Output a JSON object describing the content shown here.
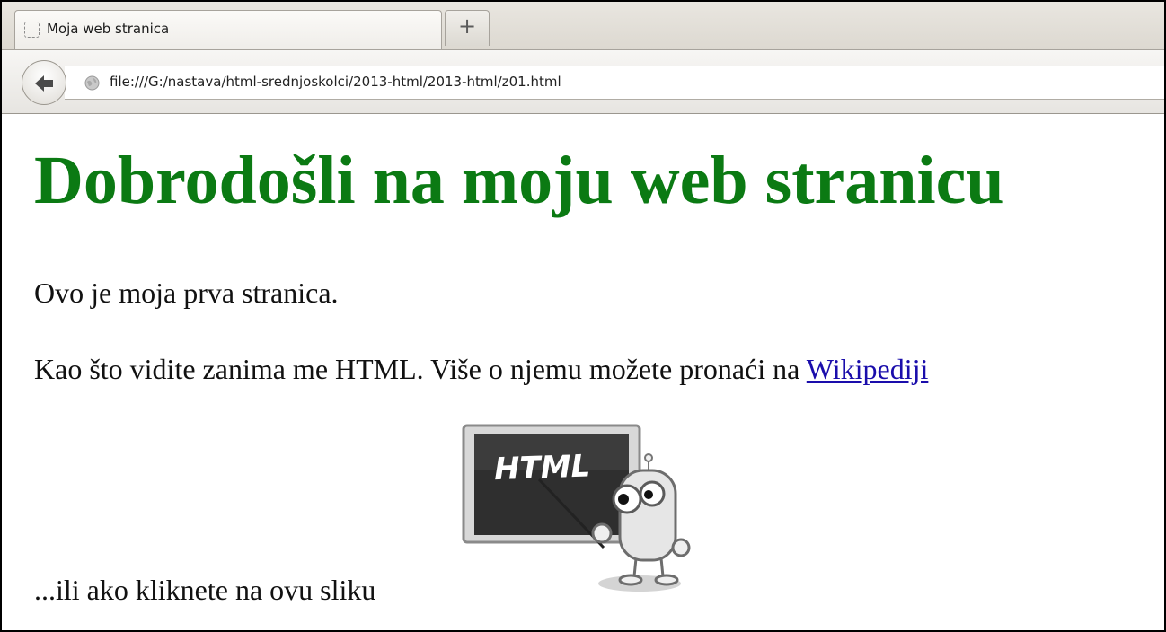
{
  "tab": {
    "title": "Moja web stranica",
    "new_tab_label": "+"
  },
  "navbar": {
    "back_icon": "back-arrow-icon",
    "url": "file:///G:/nastava/html-srednjoskolci/2013-html/2013-html/z01.html"
  },
  "page": {
    "heading": "Dobrodošli na moju web stranicu",
    "heading_color": "#0b7a13",
    "paragraph1": "Ovo je moja prva stranica.",
    "paragraph2_text": "Kao što vidite zanima me HTML. Više o njemu možete pronaći na",
    "paragraph2_link": "Wikipediji",
    "link_color": "#1a0dab",
    "paragraph3": "...ili ako kliknete na ovu sliku",
    "image": {
      "board_text": "HTML",
      "icon": "robot-teacher-icon"
    }
  }
}
